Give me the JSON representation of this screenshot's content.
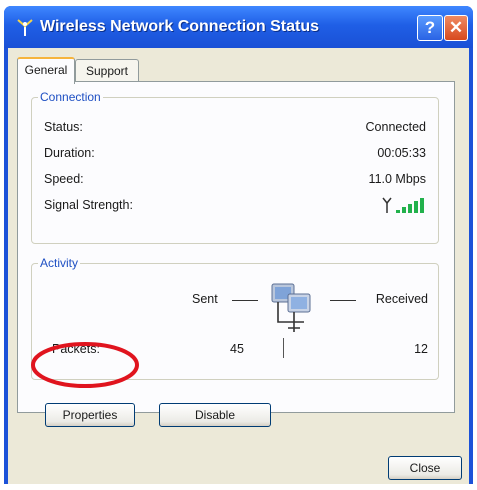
{
  "window": {
    "title": "Wireless Network Connection Status"
  },
  "titlebar_buttons": {
    "help": "?",
    "close": "✕"
  },
  "tabs": [
    {
      "label": "General",
      "selected": true
    },
    {
      "label": "Support",
      "selected": false
    }
  ],
  "connection": {
    "legend": "Connection",
    "rows": [
      {
        "label": "Status:",
        "value": "Connected"
      },
      {
        "label": "Duration:",
        "value": "00:05:33"
      },
      {
        "label": "Speed:",
        "value": "11.0 Mbps"
      },
      {
        "label": "Signal Strength:",
        "value": ""
      }
    ],
    "signal_level": 5,
    "signal_color": "#22b14c"
  },
  "activity": {
    "legend": "Activity",
    "sent_label": "Sent",
    "received_label": "Received",
    "packets_label": "Packets:",
    "packets_sent": "45",
    "packets_received": "12"
  },
  "buttons": {
    "properties": "Properties",
    "disable": "Disable",
    "close": "Close"
  },
  "annotation": {
    "color": "#e0141e"
  },
  "colors": {
    "titlebar": "#1f5fe6",
    "dialog_bg": "#ece9d8",
    "legend": "#1e4fc3"
  }
}
